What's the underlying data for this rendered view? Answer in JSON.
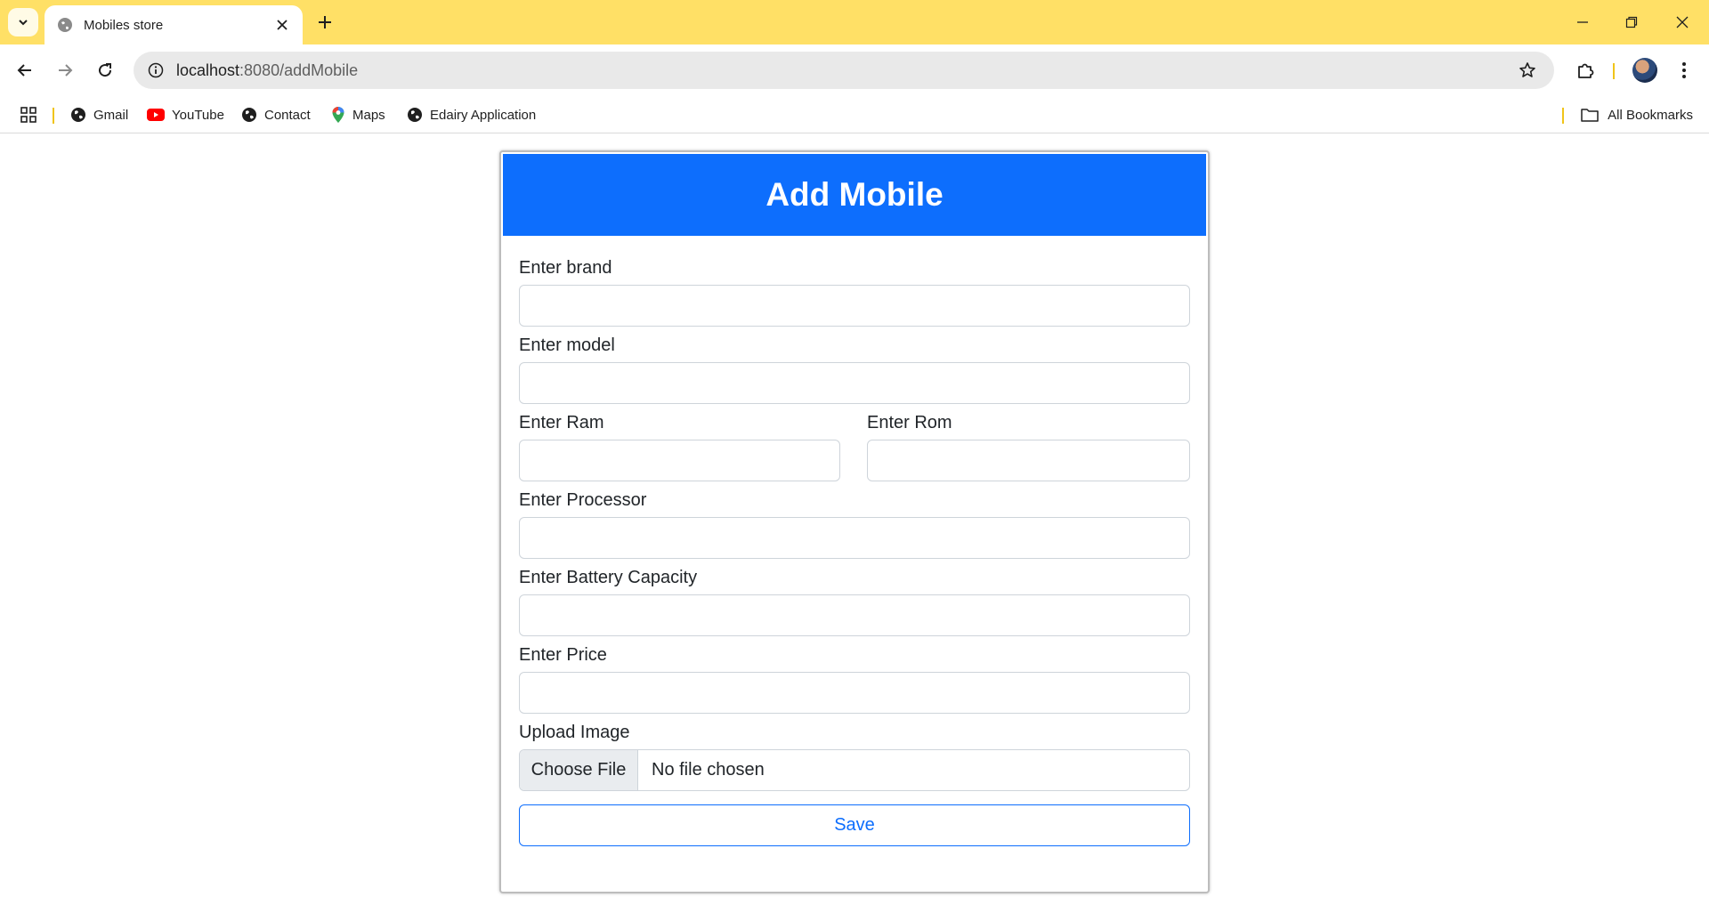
{
  "browser": {
    "tab_title": "Mobiles store",
    "url_host": "localhost",
    "url_path": ":8080/addMobile",
    "bookmarks": [
      "Gmail",
      "YouTube",
      "Contact",
      "Maps",
      "Edairy Application"
    ],
    "all_bookmarks": "All Bookmarks"
  },
  "form": {
    "title": "Add Mobile",
    "brand_label": "Enter brand",
    "model_label": "Enter model",
    "ram_label": "Enter Ram",
    "rom_label": "Enter Rom",
    "processor_label": "Enter Processor",
    "battery_label": "Enter Battery Capacity",
    "price_label": "Enter Price",
    "image_label": "Upload Image",
    "choose_file": "Choose File",
    "file_status": "No file chosen",
    "save_label": "Save"
  },
  "colors": {
    "tabstrip": "#ffe066",
    "header": "#0d6efd",
    "accent": "#0d6efd"
  }
}
